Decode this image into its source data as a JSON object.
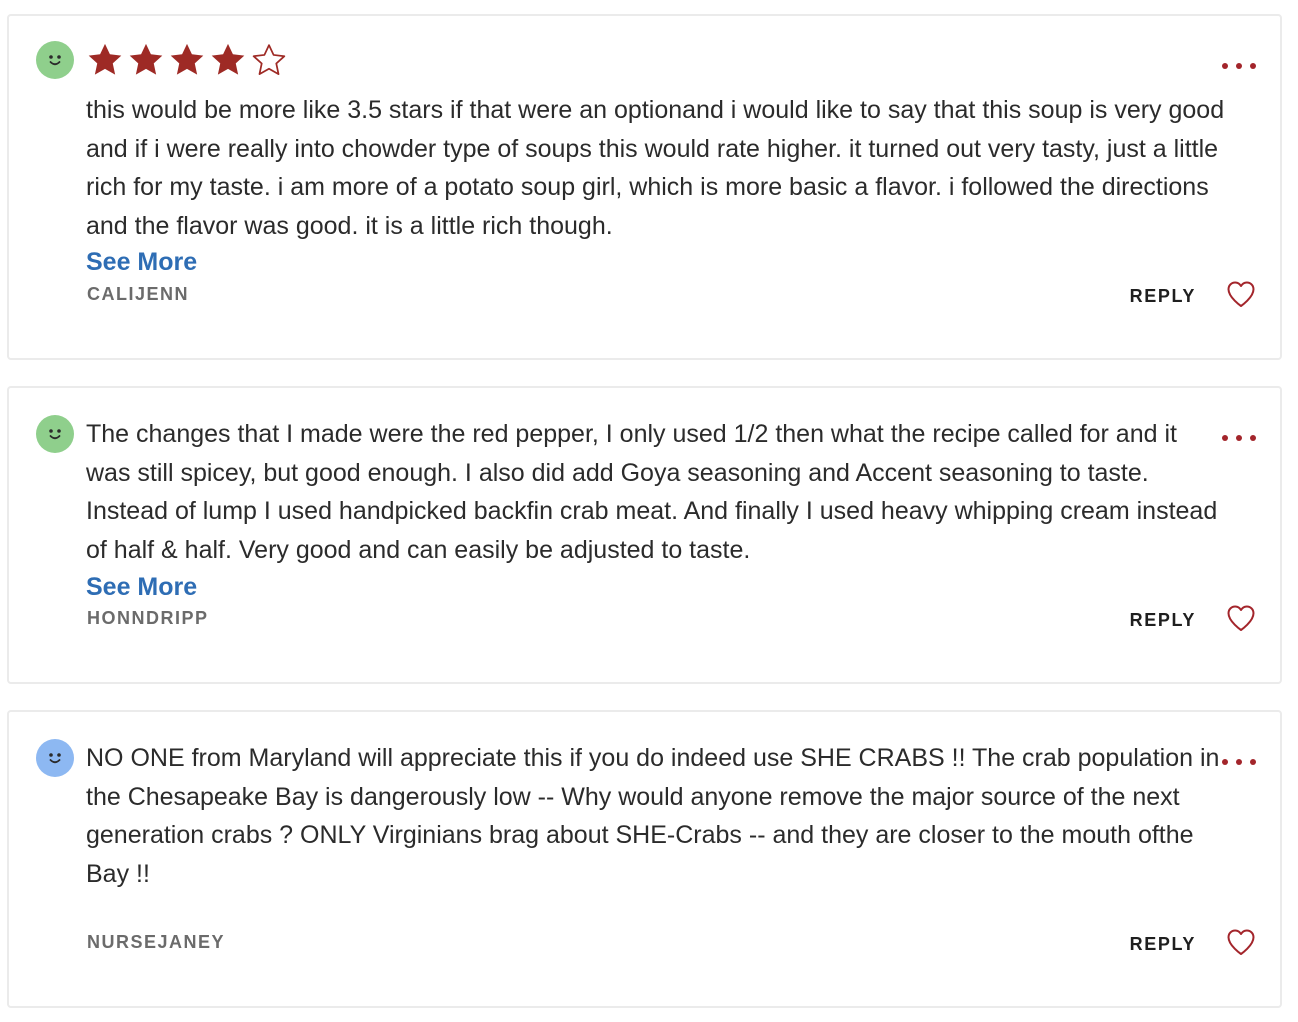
{
  "colors": {
    "star_fill": "#9e2a25",
    "link": "#2e6db4",
    "heart": "#a3252b",
    "avatar_green": "#8fcf8c",
    "avatar_blue": "#8db8f2"
  },
  "reviews": [
    {
      "avatar_color": "green",
      "avatar_icon": "smiley-icon",
      "rating": 4,
      "rating_max": 5,
      "text": "this would be more like 3.5 stars if that were an optionand i would like to say that this soup is very good and if i were really into chowder type of soups this would rate higher. it turned out very tasty, just a little rich for my taste. i am more of a potato soup girl, which is more basic a flavor. i followed the directions and the flavor was good. it is a little rich though.",
      "see_more": "See More",
      "author": "CALIJENN",
      "reply": "REPLY"
    },
    {
      "avatar_color": "green",
      "avatar_icon": "smiley-icon",
      "text": "The changes that I made were the red pepper, I only used 1/2 then what the recipe called for and it was still spicey, but good enough. I also did add Goya seasoning and Accent seasoning to taste. Instead of lump I used handpicked backfin crab meat. And finally I used heavy whipping cream instead of half & half.   Very good and can easily be adjusted to taste.",
      "see_more": "See More",
      "author": "HONNDRIPP",
      "reply": "REPLY"
    },
    {
      "avatar_color": "blue",
      "avatar_icon": "smiley-icon",
      "text": "NO ONE from Maryland will appreciate this if you do indeed use SHE CRABS !! The crab population in the Chesapeake Bay is dangerously low -- Why would anyone remove the major source of the next generation crabs ? ONLY Virginians brag about SHE-Crabs -- and they are closer to the mouth ofthe Bay !!",
      "author": "NURSEJANEY",
      "reply": "REPLY"
    }
  ]
}
